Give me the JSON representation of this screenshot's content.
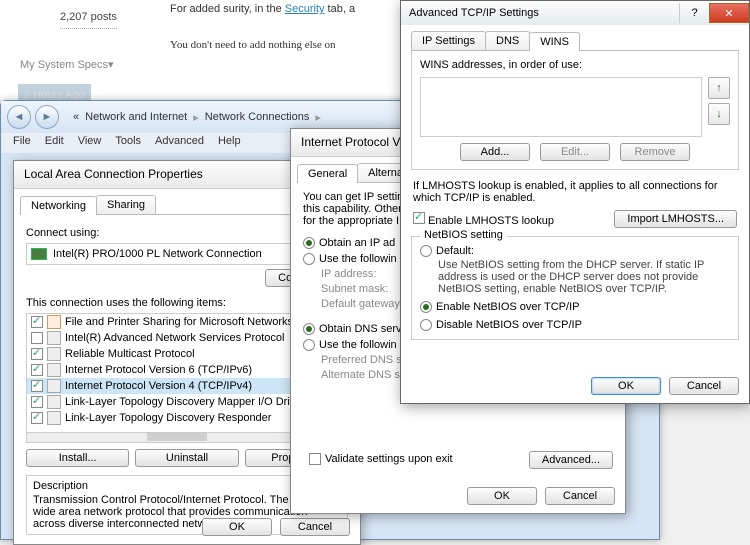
{
  "bg": {
    "posts": "2,207 posts",
    "line1_pre": "For added surity, in the ",
    "line1_link": "Security",
    "line1_post": " tab, a",
    "line2": "You don't need to add nothing else on",
    "specs": "My System Specs",
    "time": "2 Hours Ago"
  },
  "explorer": {
    "crumb1": "Network and Internet",
    "crumb2": "Network Connections",
    "menu": {
      "file": "File",
      "edit": "Edit",
      "view": "View",
      "tools": "Tools",
      "advanced": "Advanced",
      "help": "Help"
    }
  },
  "lacp": {
    "title": "Local Area Connection Properties",
    "tabs": {
      "networking": "Networking",
      "sharing": "Sharing"
    },
    "connect_using": "Connect using:",
    "nic": "Intel(R) PRO/1000 PL Network Connection",
    "configure": "Configure...",
    "uses": "This connection uses the following items:",
    "items": [
      {
        "c": true,
        "t": "File and Printer Sharing for Microsoft Networks"
      },
      {
        "c": false,
        "t": "Intel(R) Advanced Network Services Protocol"
      },
      {
        "c": true,
        "t": "Reliable Multicast Protocol"
      },
      {
        "c": true,
        "t": "Internet Protocol Version 6 (TCP/IPv6)"
      },
      {
        "c": true,
        "t": "Internet Protocol Version 4 (TCP/IPv4)",
        "sel": true
      },
      {
        "c": true,
        "t": "Link-Layer Topology Discovery Mapper I/O Driver"
      },
      {
        "c": true,
        "t": "Link-Layer Topology Discovery Responder"
      }
    ],
    "install": "Install...",
    "uninstall": "Uninstall",
    "properties": "Properties",
    "desc_h": "Description",
    "desc": "Transmission Control Protocol/Internet Protocol. The default wide area network protocol that provides communication across diverse interconnected networks.",
    "ok": "OK",
    "cancel": "Cancel"
  },
  "ipv4": {
    "title": "Internet Protocol Vers",
    "tabs": {
      "general": "General",
      "alt": "Alternate Con"
    },
    "intro1": "You can get IP settin",
    "intro2": "this capability. Other",
    "intro3": "for the appropriate I",
    "auto_ip": "Obtain an IP ad",
    "use_ip": "Use the followin",
    "ip": "IP address:",
    "mask": "Subnet mask:",
    "gw": "Default gateway:",
    "auto_dns": "Obtain DNS serv",
    "use_dns": "Use the followin",
    "pdns": "Preferred DNS se",
    "adns": "Alternate DNS server",
    "validate": "Validate settings upon exit",
    "advanced": "Advanced...",
    "ok": "OK",
    "cancel": "Cancel"
  },
  "adv": {
    "title": "Advanced TCP/IP Settings",
    "tabs": {
      "ip": "IP Settings",
      "dns": "DNS",
      "wins": "WINS"
    },
    "wins_label": "WINS addresses, in order of use:",
    "add": "Add...",
    "edit": "Edit...",
    "remove": "Remove",
    "lm_note": "If LMHOSTS lookup is enabled, it applies to all connections for which TCP/IP is enabled.",
    "enable_lm": "Enable LMHOSTS lookup",
    "import": "Import LMHOSTS...",
    "nb_legend": "NetBIOS setting",
    "nb_default": "Default:",
    "nb_desc": "Use NetBIOS setting from the DHCP server. If static IP address is used or the DHCP server does not provide NetBIOS setting, enable NetBIOS over TCP/IP.",
    "nb_enable": "Enable NetBIOS over TCP/IP",
    "nb_disable": "Disable NetBIOS over TCP/IP",
    "ok": "OK",
    "cancel": "Cancel"
  }
}
